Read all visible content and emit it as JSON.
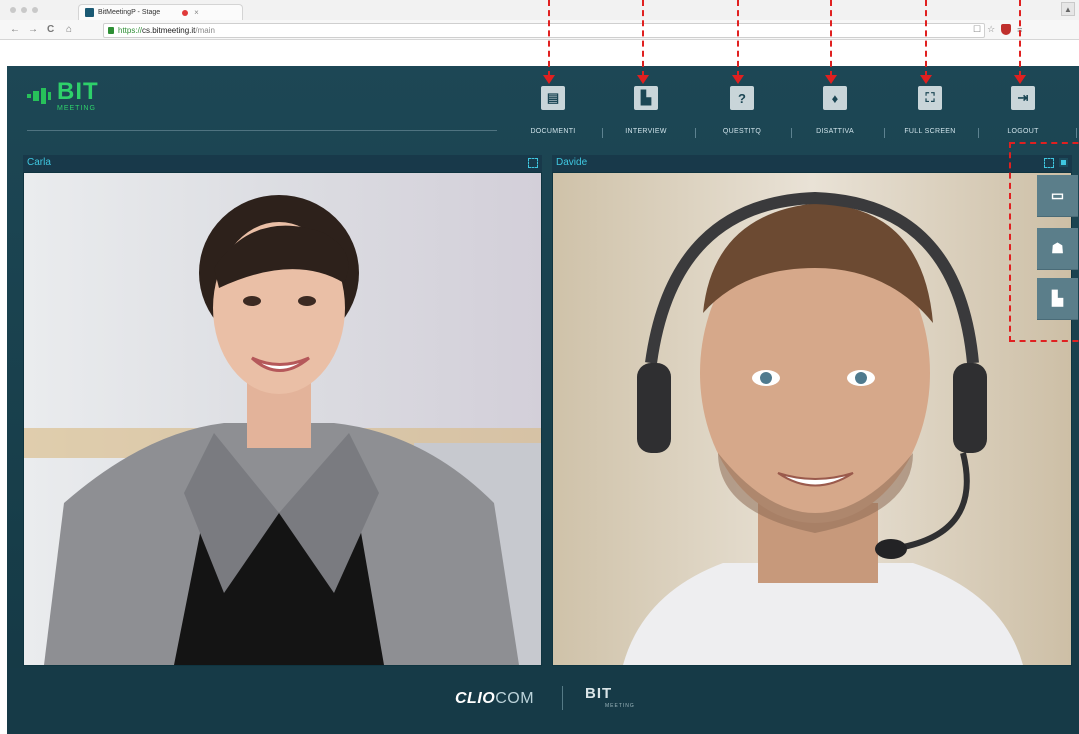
{
  "browser": {
    "tab_title": "BitMeetingP - Stage",
    "tab_close": "×",
    "url_scheme": "https://",
    "url_host": "cs.bitmeeting.it",
    "url_path": "/main",
    "back": "←",
    "forward": "→",
    "reload": "C",
    "home": "⌂"
  },
  "brand": {
    "name": "BIT",
    "subtitle": "MEETING"
  },
  "toolbar": {
    "items": [
      {
        "label": "DOCUMENTI",
        "icon": "documents-icon"
      },
      {
        "label": "INTERVIEW",
        "icon": "interview-icon"
      },
      {
        "label": "QUESTITQ",
        "icon": "question-icon"
      },
      {
        "label": "DISATTIVA",
        "icon": "microphone-icon"
      },
      {
        "label": "FULL SCREEN",
        "icon": "fullscreen-icon"
      },
      {
        "label": "LOGOUT",
        "icon": "logout-icon"
      }
    ]
  },
  "participants": [
    {
      "name": "Carla"
    },
    {
      "name": "Davide"
    }
  ],
  "side_actions": [
    {
      "icon": "chat-icon"
    },
    {
      "icon": "participants-icon"
    },
    {
      "icon": "interview-icon"
    }
  ],
  "footer": {
    "partner": "CLIO",
    "partner_suffix": "COM",
    "product": "BIT",
    "product_sub": "MEETING"
  },
  "colors": {
    "accent": "#3fc7e0",
    "brand_green": "#2ed06a",
    "annotation_red": "#e02020",
    "app_bg": "#1d4755"
  }
}
